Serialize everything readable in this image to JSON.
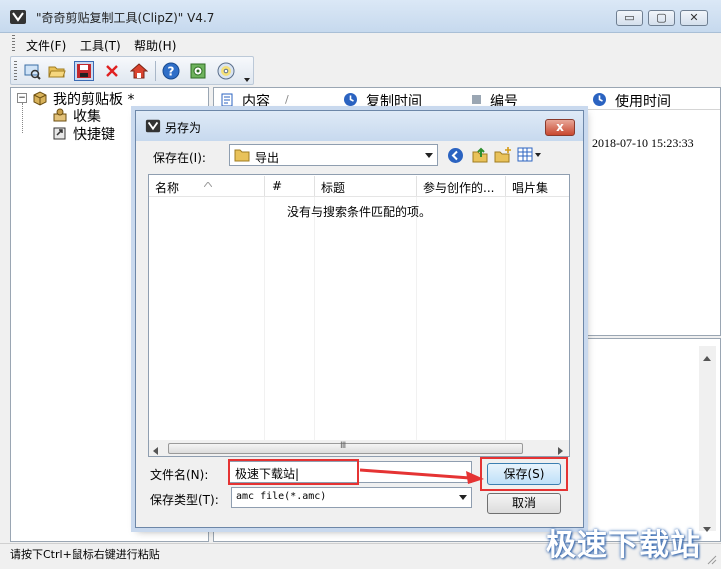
{
  "window": {
    "title": "\"奇奇剪贴复制工具(ClipZ)\" V4.7",
    "min_glyph": "▭",
    "max_glyph": "▢",
    "close_glyph": "✕"
  },
  "menu": {
    "file": "文件(F)",
    "tools": "工具(T)",
    "help": "帮助(H)"
  },
  "toolbar": {
    "icons": [
      "view-icon",
      "open-icon",
      "save-icon",
      "delete-icon",
      "home-icon",
      "help-icon",
      "settings-icon",
      "disc-icon",
      "overflow-chevron-icon"
    ]
  },
  "tree": {
    "root": "我的剪贴板 *",
    "items": [
      "收集",
      "快捷键"
    ]
  },
  "list": {
    "columns": [
      "内容",
      "复制时间",
      "编号",
      "使用时间"
    ],
    "sort_mark": "/",
    "row_time": "2018-07-10 15:23:33"
  },
  "status": "请按下Ctrl+鼠标右键进行粘贴",
  "dialog": {
    "title": "另存为",
    "close_glyph": "x",
    "save_in_label": "保存在(I):",
    "save_in_value": "导出",
    "columns": [
      "名称",
      "#",
      "标题",
      "参与创作的...",
      "唱片集"
    ],
    "empty_message": "没有与搜索条件匹配的项。",
    "hscroll_mid": "Ⅲ",
    "filename_label": "文件名(N):",
    "filename_value": "极速下载站|",
    "filetype_label": "保存类型(T):",
    "filetype_value": "amc file(*.amc)",
    "save_button": "保存(S)",
    "cancel_button": "取消"
  },
  "watermark": "极速下载站",
  "colors": {
    "accent": "#2b63c1",
    "highlight_red": "#e53333"
  }
}
